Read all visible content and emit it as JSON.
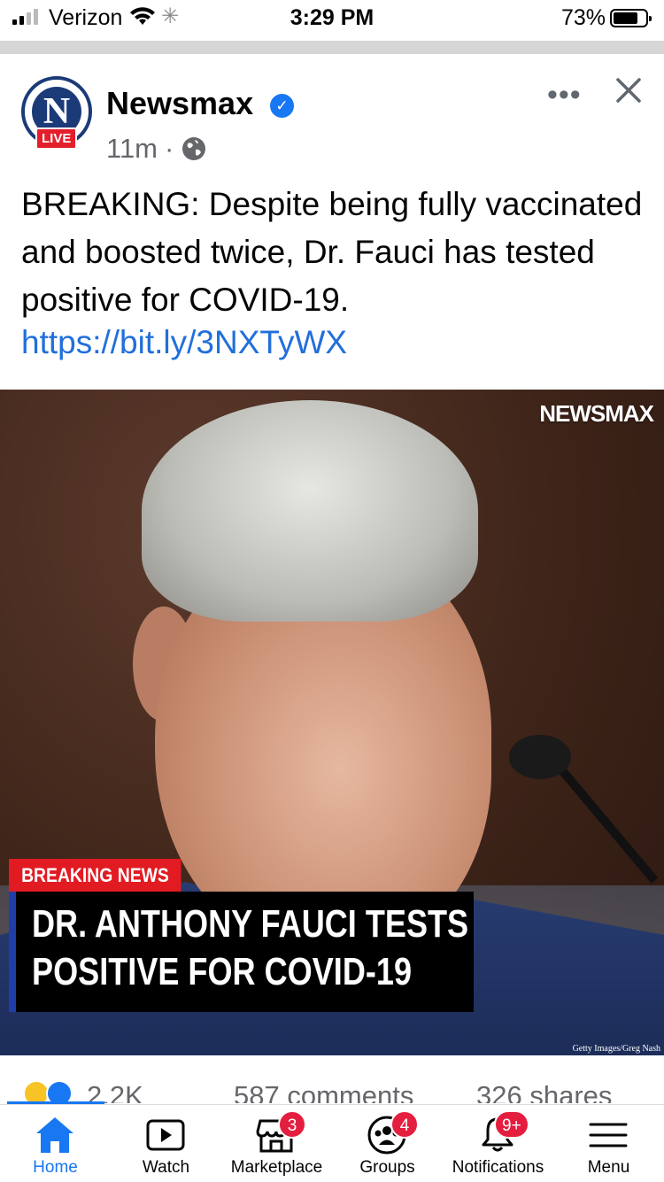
{
  "status_bar": {
    "carrier": "Verizon",
    "time": "3:29 PM",
    "battery": "73%"
  },
  "post": {
    "page_name": "Newsmax",
    "live_badge": "LIVE",
    "time_ago": "11m",
    "separator": "·",
    "text": "BREAKING: Despite being fully vaccinated and boosted twice, Dr. Fauci has tested positive for COVID-19.",
    "link": "https://bit.ly/3NXTyWX",
    "more_label": "•••",
    "image": {
      "brand_watermark": "NEWSMAX",
      "breaking_label": "BREAKING NEWS",
      "headline_line1": "DR. ANTHONY FAUCI TESTS",
      "headline_line2": "POSITIVE FOR COVID-19",
      "credit": "Getty Images/Greg Nash"
    },
    "reactions": {
      "count": "2.2K",
      "comments": "587 comments",
      "shares": "326 shares"
    }
  },
  "tab_bar": {
    "items": [
      {
        "label": "Home",
        "active": true
      },
      {
        "label": "Watch"
      },
      {
        "label": "Marketplace",
        "badge": "3"
      },
      {
        "label": "Groups",
        "badge": "4"
      },
      {
        "label": "Notifications",
        "badge": "9+"
      },
      {
        "label": "Menu"
      }
    ]
  },
  "colors": {
    "facebook_blue": "#1877f2",
    "link_blue": "#216fdb",
    "badge_red": "#e41e3f",
    "newsmax_red": "#e21b23"
  }
}
